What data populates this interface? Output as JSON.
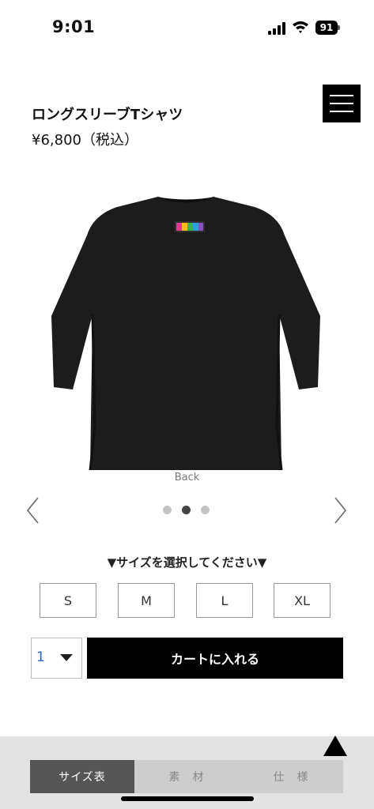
{
  "status": {
    "time": "9:01",
    "battery": "91",
    "icons": [
      "signal-icon",
      "wifi-icon",
      "battery-icon"
    ]
  },
  "header": {
    "title": "ロングスリーブTシャツ",
    "price": "¥6,800（税込）",
    "menu_icon": "hamburger-menu-icon"
  },
  "gallery": {
    "caption": "Back",
    "total_slides": 3,
    "active_slide": 2,
    "prev_icon": "chevron-left-icon",
    "next_icon": "chevron-right-icon"
  },
  "size": {
    "prompt": "▼サイズを選択してください▼",
    "options": [
      "S",
      "M",
      "L",
      "XL"
    ]
  },
  "purchase": {
    "quantity": "1",
    "cart_label": "カートに入れる"
  },
  "bottom": {
    "scroll_top_icon": "triangle-up-icon",
    "tabs": [
      "サイズ表",
      "素　材",
      "仕　様"
    ],
    "active_tab": 0
  },
  "colors": {
    "accent": "#000000",
    "quantity_text": "#2b63c6",
    "tab_active_bg": "#555555",
    "tab_bg": "#cdcdcd",
    "panel_bg": "#e3e3e3"
  }
}
